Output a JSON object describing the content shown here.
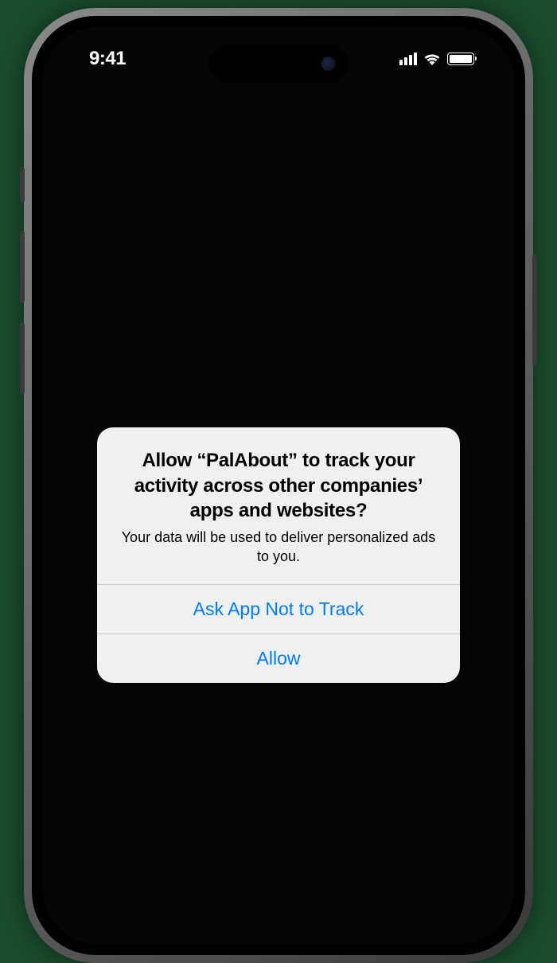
{
  "statusBar": {
    "time": "9:41"
  },
  "alert": {
    "title": "Allow “PalAbout” to track your activity across other companies’ apps and websites?",
    "message": "Your data will be used to deliver personalized ads to you.",
    "denyButton": "Ask App Not to Track",
    "allowButton": "Allow"
  }
}
